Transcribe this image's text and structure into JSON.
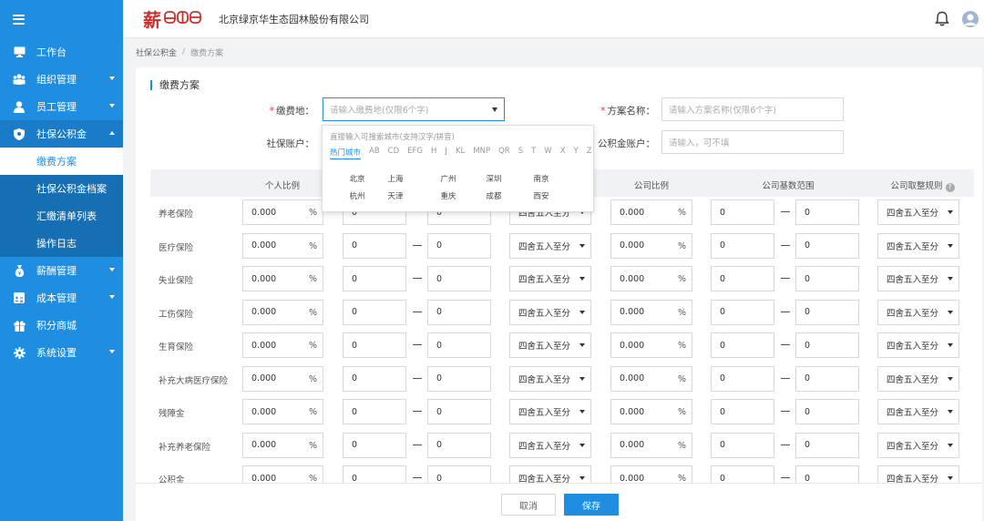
{
  "company": "北京绿京华生态园林股份有限公司",
  "logo_char": "薪",
  "sidebar": {
    "items": [
      {
        "label": "工作台",
        "icon": "monitor-icon"
      },
      {
        "label": "组织管理",
        "icon": "org-icon"
      },
      {
        "label": "员工管理",
        "icon": "user-icon"
      },
      {
        "label": "社保公积金",
        "icon": "shield-icon"
      },
      {
        "label": "薪酬管理",
        "icon": "money-bag-icon"
      },
      {
        "label": "成本管理",
        "icon": "calculator-icon"
      },
      {
        "label": "积分商城",
        "icon": "gift-icon"
      },
      {
        "label": "系统设置",
        "icon": "gear-icon"
      }
    ],
    "subitems": [
      "缴费方案",
      "社保公积金档案",
      "汇缴清单列表",
      "操作日志"
    ]
  },
  "breadcrumb": {
    "parent": "社保公积金",
    "current": "缴费方案"
  },
  "section_title": "缴费方案",
  "form": {
    "place_label": "缴费地：",
    "place_placeholder": "请输入缴费地(仅限6个字)",
    "plan_label": "方案名称：",
    "plan_placeholder": "请输入方案名称(仅限6个字)",
    "si_account_label": "社保账户：",
    "hf_account_label": "公积金账户：",
    "hf_account_placeholder": "请输入，可不填",
    "required_mark": "*"
  },
  "table": {
    "headers": {
      "personal_ratio": "个人比例",
      "company_ratio": "公司比例",
      "company_base": "公司基数范围",
      "company_rounding": "公司取整规则"
    },
    "range_dash": "—",
    "percent": "%",
    "rounding_value": "四舍五入至分",
    "rows": [
      {
        "name": "养老保险",
        "p_ratio": "0.000",
        "p_min": "0",
        "p_max": "0",
        "c_ratio": "0.000",
        "c_min": "0",
        "c_max": "0"
      },
      {
        "name": "医疗保险",
        "p_ratio": "0.000",
        "p_min": "0",
        "p_max": "0",
        "c_ratio": "0.000",
        "c_min": "0",
        "c_max": "0"
      },
      {
        "name": "失业保险",
        "p_ratio": "0.000",
        "p_min": "0",
        "p_max": "0",
        "c_ratio": "0.000",
        "c_min": "0",
        "c_max": "0"
      },
      {
        "name": "工伤保险",
        "p_ratio": "0.000",
        "p_min": "0",
        "p_max": "0",
        "c_ratio": "0.000",
        "c_min": "0",
        "c_max": "0"
      },
      {
        "name": "生育保险",
        "p_ratio": "0.000",
        "p_min": "0",
        "p_max": "0",
        "c_ratio": "0.000",
        "c_min": "0",
        "c_max": "0"
      },
      {
        "name": "补充大病医疗保险",
        "p_ratio": "0.000",
        "p_min": "0",
        "p_max": "0",
        "c_ratio": "0.000",
        "c_min": "0",
        "c_max": "0"
      },
      {
        "name": "残障金",
        "p_ratio": "0.000",
        "p_min": "0",
        "p_max": "0",
        "c_ratio": "0.000",
        "c_min": "0",
        "c_max": "0"
      },
      {
        "name": "补充养老保险",
        "p_ratio": "0.000",
        "p_min": "0",
        "p_max": "0",
        "c_ratio": "0.000",
        "c_min": "0",
        "c_max": "0"
      },
      {
        "name": "公积金",
        "p_ratio": "0.000",
        "p_min": "0",
        "p_max": "0",
        "c_ratio": "0.000",
        "c_min": "0",
        "c_max": "0"
      }
    ]
  },
  "footer": {
    "cancel": "取消",
    "save": "保存"
  },
  "dropdown": {
    "hint": "直接输入可搜索城市(支持汉字/拼音)",
    "tabs": [
      "热门城市",
      "AB",
      "CD",
      "EFG",
      "H",
      "J",
      "KL",
      "MNP",
      "QR",
      "S",
      "T",
      "W",
      "X",
      "Y",
      "Z"
    ],
    "cities": [
      [
        "北京",
        "上海",
        "广州",
        "深圳",
        "南京"
      ],
      [
        "杭州",
        "天津",
        "重庆",
        "成都",
        "西安"
      ]
    ]
  },
  "colors": {
    "accent": "#1f8ee0",
    "sidebar": "#1f8ee0",
    "logo": "#c9302c"
  }
}
